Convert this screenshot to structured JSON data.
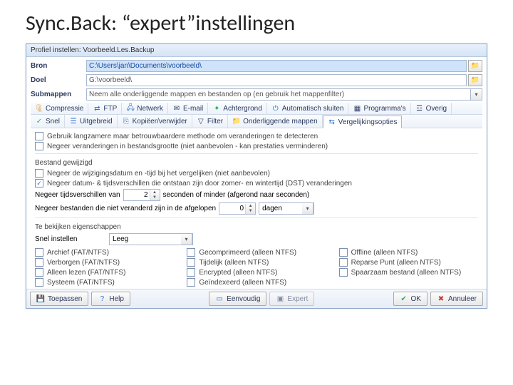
{
  "slide": {
    "title": "Sync.Back: “expert”instellingen"
  },
  "window": {
    "title": "Profiel instellen: Voorbeeld.Les.Backup"
  },
  "fields": {
    "bron_label": "Bron",
    "bron_value": "C:\\Users\\jan\\Documents\\voorbeeld\\",
    "doel_label": "Doel",
    "doel_value": "G:\\voorbeeld\\",
    "submappen_label": "Submappen",
    "submappen_value": "Neem alle onderliggende mappen en bestanden op (en gebruik het mappenfilter)"
  },
  "tabs_row1": {
    "compressie": "Compressie",
    "ftp": "FTP",
    "netwerk": "Netwerk",
    "email": "E-mail",
    "achtergrond": "Achtergrond",
    "autosluiten": "Automatisch sluiten",
    "programmas": "Programma's",
    "overig": "Overig"
  },
  "tabs_row2": {
    "snel": "Snel",
    "uitgebreid": "Uitgebreid",
    "kopieer": "Kopiëer/verwijder",
    "filter": "Filter",
    "onderliggende": "Onderliggende mappen",
    "vergelijk": "Vergelijkingsopties"
  },
  "options": {
    "opt1": "Gebruik langzamere maar betrouwbaardere methode om veranderingen te detecteren",
    "opt2": "Negeer veranderingen in bestandsgrootte (niet aanbevolen - kan prestaties verminderen)",
    "section_changed": "Bestand gewijzigd",
    "opt3": "Negeer de wijzigingsdatum en -tijd bij het vergelijken (niet aanbevolen)",
    "opt4": "Negeer datum- & tijdsverschillen die ontstaan zijn door zomer- en wintertijd (DST) veranderingen",
    "ignore_sec_label_a": "Negeer tijdsverschillen van",
    "ignore_sec_value": "2",
    "ignore_sec_label_b": "seconden of minder (afgerond naar seconden)",
    "ignore_days_label": "Negeer bestanden die niet veranderd zijn in de afgelopen",
    "ignore_days_value": "0",
    "ignore_days_unit": "dagen",
    "section_props": "Te bekijken eigenschappen",
    "snel_instellen_label": "Snel instellen",
    "snel_instellen_value": "Leeg"
  },
  "props": {
    "c1a": "Archief (FAT/NTFS)",
    "c1b": "Verborgen (FAT/NTFS)",
    "c1c": "Alleen lezen (FAT/NTFS)",
    "c1d": "Systeem (FAT/NTFS)",
    "c2a": "Gecomprimeerd (alleen NTFS)",
    "c2b": "Tijdelijk (alleen NTFS)",
    "c2c": "Encrypted (alleen NTFS)",
    "c2d": "Geïndexeerd (alleen NTFS)",
    "c3a": "Offline (alleen NTFS)",
    "c3b": "Reparse Punt (alleen NTFS)",
    "c3c": "Spaarzaam bestand (alleen NTFS)"
  },
  "buttons": {
    "toepassen": "Toepassen",
    "help": "Help",
    "eenvoudig": "Eenvoudig",
    "expert": "Expert",
    "ok": "OK",
    "annuleer": "Annuleer"
  }
}
